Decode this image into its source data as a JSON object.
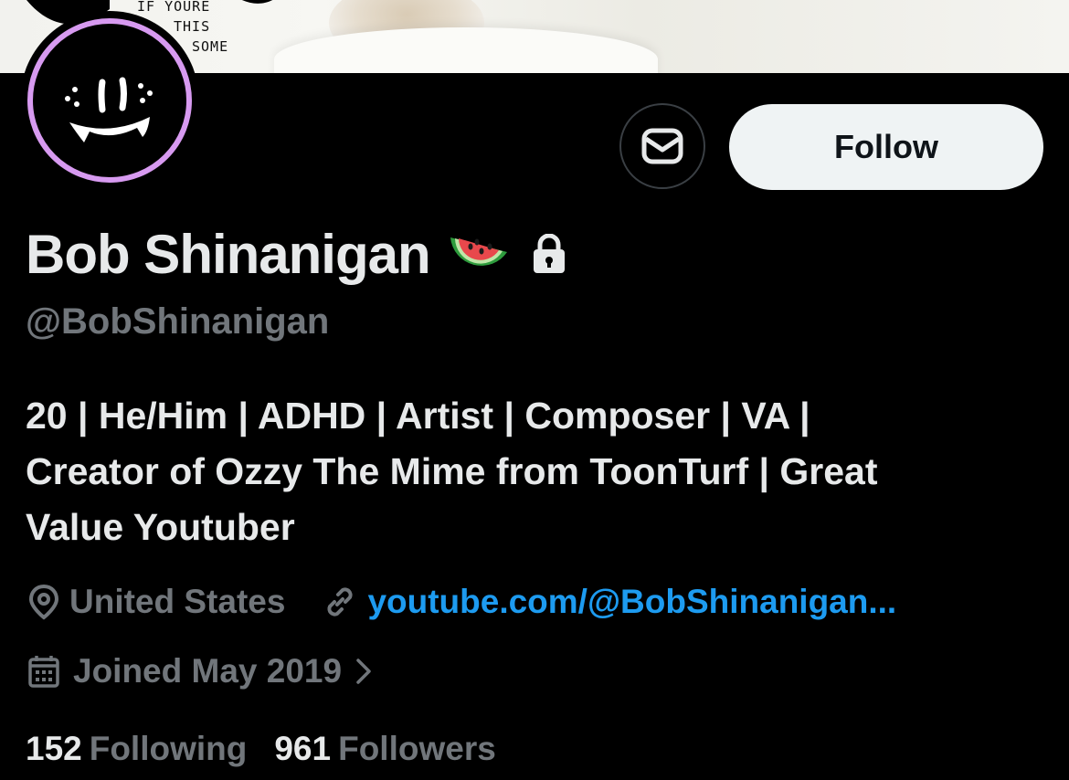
{
  "banner": {
    "scribble_lines": [
      "IF YOURE",
      "THIS",
      "SOME"
    ]
  },
  "profile": {
    "display_name": "Bob Shinanigan",
    "name_emoji": "watermelon",
    "protected_icon": "lock-icon",
    "handle": "@BobShinanigan",
    "bio_lines": [
      "20 | He/Him | ADHD | Artist | Composer | VA |",
      "Creator of Ozzy The Mime from ToonTurf | Great",
      "Value Youtuber"
    ],
    "location": "United States",
    "website": "youtube.com/@BobShinanigan...",
    "joined": "Joined May 2019",
    "following_count": "152",
    "following_label": "Following",
    "followers_count": "961",
    "followers_label": "Followers"
  },
  "actions": {
    "message_icon": "envelope-icon",
    "follow_label": "Follow"
  },
  "colors": {
    "background": "#000000",
    "text_primary": "#e7e9ea",
    "text_secondary": "#71767b",
    "link": "#1d9bf0",
    "follow_button_bg": "#eff3f4",
    "avatar_ring": "#d79af0"
  }
}
